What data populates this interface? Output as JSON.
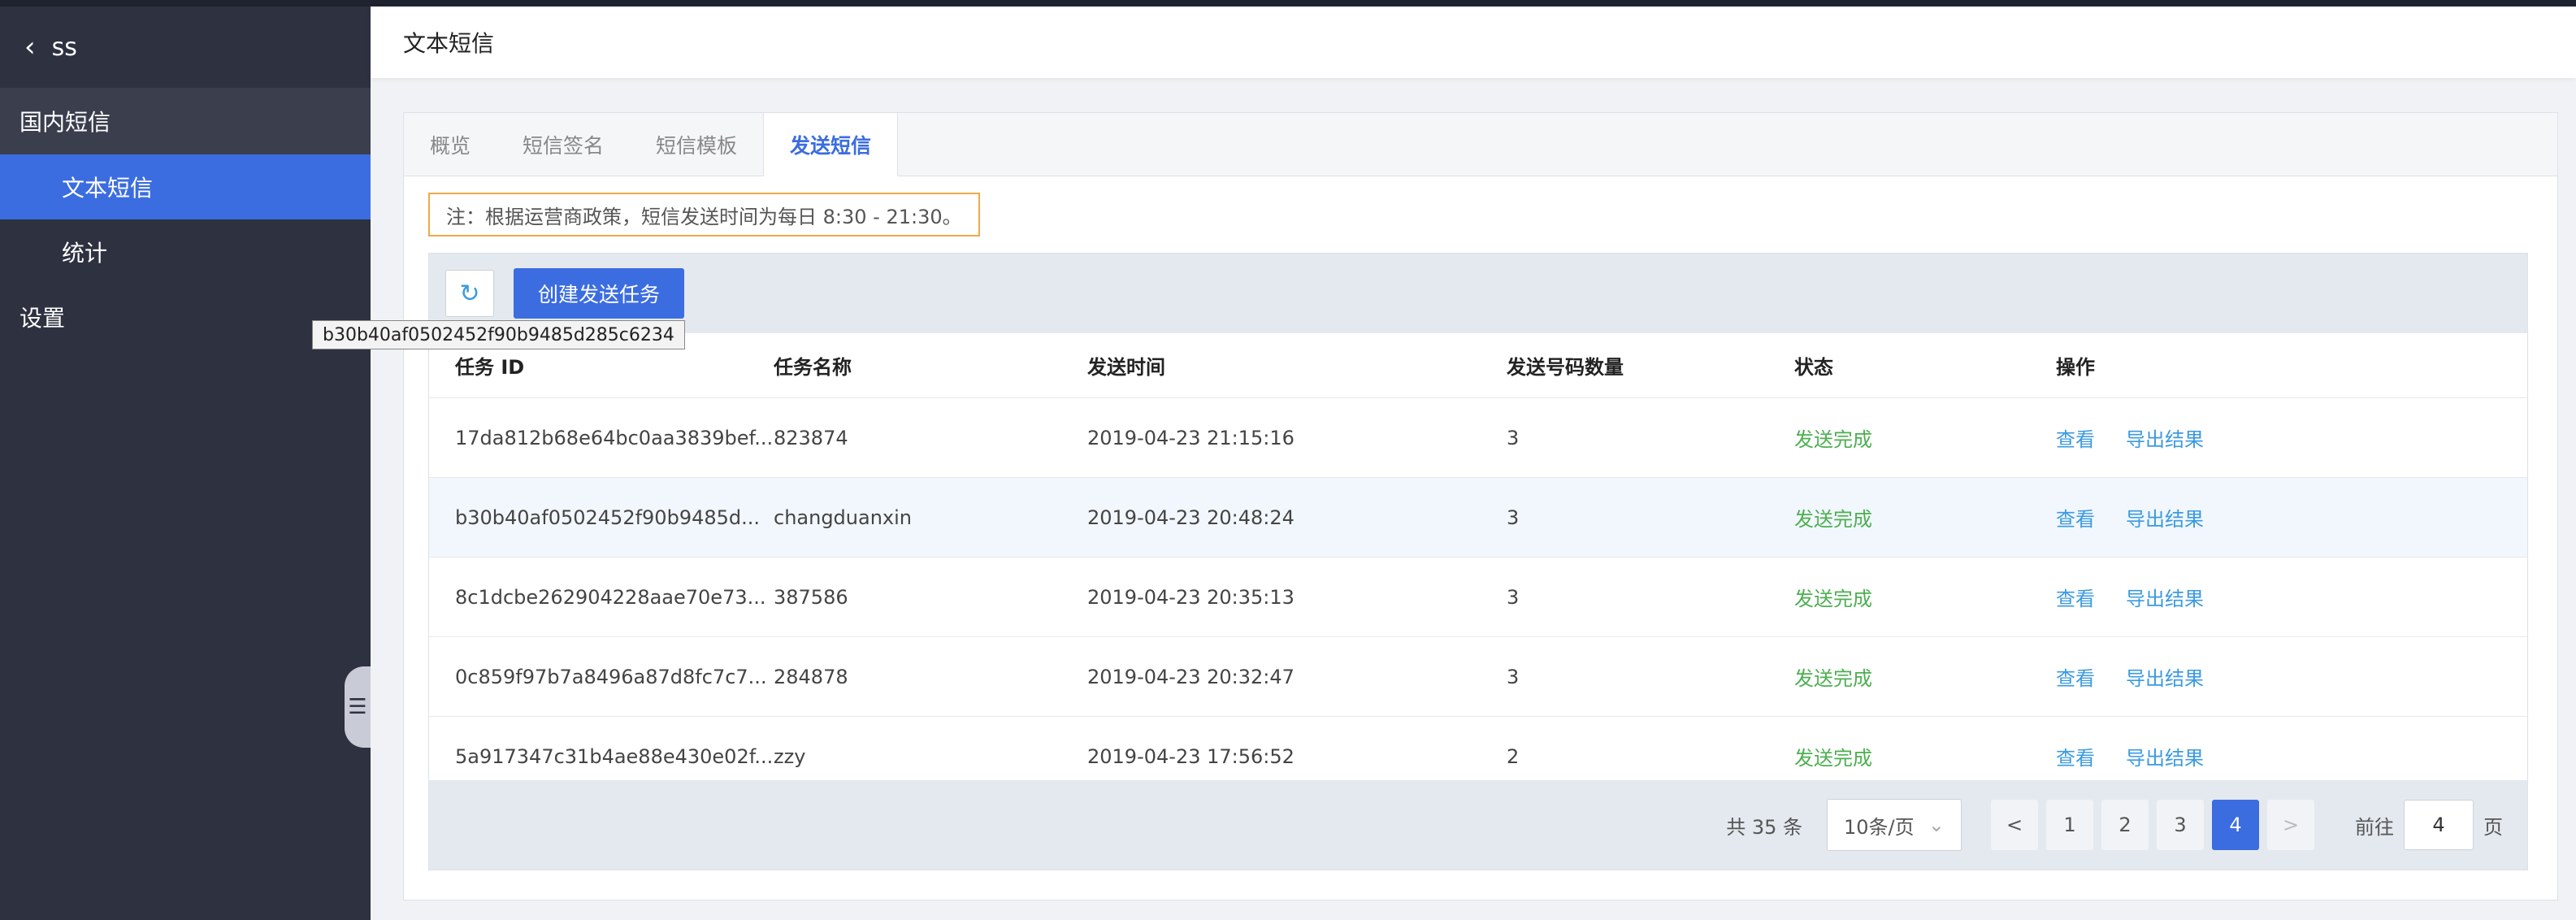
{
  "sidebar": {
    "back_icon": "chevron-left-icon",
    "app_name": "ss",
    "group_label": "国内短信",
    "items": [
      {
        "label": "文本短信",
        "active": true
      },
      {
        "label": "统计",
        "active": false
      }
    ],
    "settings_label": "设置",
    "collapse_icon": "menu-collapse-icon"
  },
  "tooltip": "b30b40af0502452f90b9485d285c6234",
  "header": {
    "title": "文本短信"
  },
  "tabs": [
    {
      "label": "概览",
      "active": false
    },
    {
      "label": "短信签名",
      "active": false
    },
    {
      "label": "短信模板",
      "active": false
    },
    {
      "label": "发送短信",
      "active": true
    }
  ],
  "notice": "注：根据运营商政策，短信发送时间为每日 8:30 - 21:30。",
  "toolbar": {
    "refresh_icon": "refresh-icon",
    "create_label": "创建发送任务"
  },
  "columns": [
    "任务 ID",
    "任务名称",
    "发送时间",
    "发送号码数量",
    "状态",
    "操作"
  ],
  "rows": [
    {
      "id": "17da812b68e64bc0aa3839bef...",
      "name": "823874",
      "time": "2019-04-23 21:15:16",
      "count": "3",
      "status": "发送完成",
      "view": "查看",
      "export": "导出结果"
    },
    {
      "id": "b30b40af0502452f90b9485d...",
      "name": "changduanxin",
      "time": "2019-04-23 20:48:24",
      "count": "3",
      "status": "发送完成",
      "view": "查看",
      "export": "导出结果"
    },
    {
      "id": "8c1dcbe262904228aae70e73...",
      "name": "387586",
      "time": "2019-04-23 20:35:13",
      "count": "3",
      "status": "发送完成",
      "view": "查看",
      "export": "导出结果"
    },
    {
      "id": "0c859f97b7a8496a87d8fc7c7...",
      "name": "284878",
      "time": "2019-04-23 20:32:47",
      "count": "3",
      "status": "发送完成",
      "view": "查看",
      "export": "导出结果"
    },
    {
      "id": "5a917347c31b4ae88e430e02f...",
      "name": "zzy",
      "time": "2019-04-23 17:56:52",
      "count": "2",
      "status": "发送完成",
      "view": "查看",
      "export": "导出结果"
    }
  ],
  "pagination": {
    "total": "共 35 条",
    "page_size": "10条/页",
    "prev": "<",
    "pages": [
      "1",
      "2",
      "3",
      "4"
    ],
    "current": "4",
    "next": ">",
    "goto_label": "前往",
    "goto_value": "4",
    "goto_suffix": "页"
  }
}
